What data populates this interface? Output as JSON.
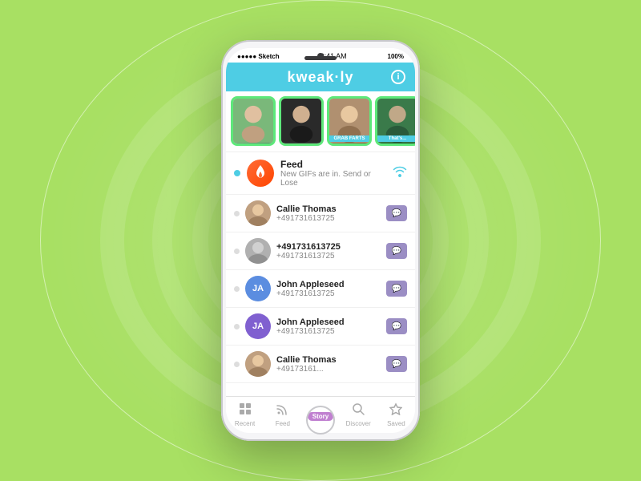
{
  "background": {
    "colors": [
      "#a8e063",
      "#b5eb6e",
      "#c2f27a"
    ]
  },
  "phone": {
    "status_bar": {
      "carrier": "●●●●● Sketch",
      "time": "9:41 AM",
      "battery": "100%"
    },
    "header": {
      "title": "kweak·ly",
      "info_label": "i"
    },
    "stories": [
      {
        "id": "story1",
        "color": "green",
        "label": ""
      },
      {
        "id": "story2",
        "color": "dark",
        "label": ""
      },
      {
        "id": "story3",
        "color": "brown",
        "label": "GRAB FARTS"
      },
      {
        "id": "story4",
        "color": "darkgreen",
        "label": "That's..."
      }
    ],
    "feed": {
      "title": "Feed",
      "subtitle": "New GIFs are in. Send or Lose"
    },
    "contacts": [
      {
        "name": "Callie Thomas",
        "phone": "+491731613725",
        "avatar_type": "photo",
        "initials": ""
      },
      {
        "name": "+491731613725",
        "phone": "+491731613725",
        "avatar_type": "grey",
        "initials": ""
      },
      {
        "name": "John Appleseed",
        "phone": "+491731613725",
        "avatar_type": "blue",
        "initials": "JA"
      },
      {
        "name": "John Appleseed",
        "phone": "+491731613725",
        "avatar_type": "purple",
        "initials": "JA"
      },
      {
        "name": "Callie Thomas",
        "phone": "+49173161...",
        "avatar_type": "photo",
        "initials": ""
      }
    ],
    "tabs": [
      {
        "id": "recent",
        "icon": "📋",
        "label": "Recent",
        "active": false
      },
      {
        "id": "feed",
        "icon": "📡",
        "label": "Feed",
        "active": false
      },
      {
        "id": "story",
        "icon": "story",
        "label": "Story",
        "active": true
      },
      {
        "id": "discover",
        "icon": "🔍",
        "label": "Discover",
        "active": false
      },
      {
        "id": "saved",
        "icon": "☆",
        "label": "Saved",
        "active": false
      }
    ]
  }
}
